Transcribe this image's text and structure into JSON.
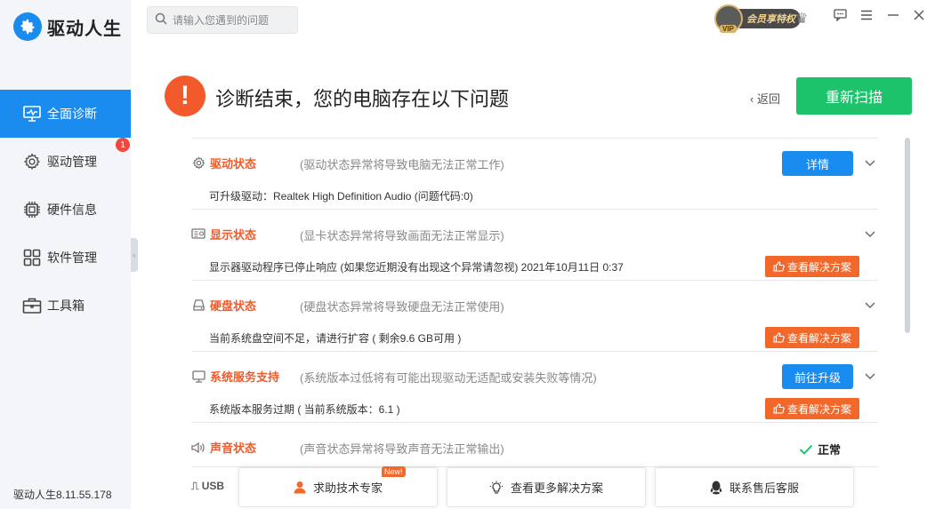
{
  "app": {
    "name": "驱动人生",
    "version": "驱动人生8.11.55.178"
  },
  "search": {
    "placeholder": "请输入您遇到的问题"
  },
  "vip": {
    "tag": "VIP",
    "label": "会员享特权"
  },
  "sidebar": {
    "items": [
      {
        "label": "全面诊断",
        "icon": "monitor-icon",
        "active": true
      },
      {
        "label": "驱动管理",
        "icon": "gear-icon",
        "badge": "1"
      },
      {
        "label": "硬件信息",
        "icon": "chip-icon"
      },
      {
        "label": "软件管理",
        "icon": "grid-icon"
      },
      {
        "label": "工具箱",
        "icon": "toolbox-icon"
      }
    ]
  },
  "header": {
    "title": "诊断结束，您的电脑存在以下问题",
    "back": "返回",
    "rescan": "重新扫描"
  },
  "diagnostics": [
    {
      "name": "驱动状态",
      "desc": "(驱动状态异常将导致电脑无法正常工作)",
      "detail": "可升级驱动：Realtek High Definition Audio (问题代码:0)",
      "button": "详情",
      "icon": "gear-icon"
    },
    {
      "name": "显示状态",
      "desc": "(显卡状态异常将导致画面无法正常显示)",
      "detail": "显示器驱动程序已停止响应 (如果您近期没有出现这个异常请忽视) 2021年10月11日 0:37",
      "solution": "查看解决方案",
      "icon": "display-card-icon"
    },
    {
      "name": "硬盘状态",
      "desc": "(硬盘状态异常将导致硬盘无法正常使用)",
      "detail": "当前系统盘空间不足，请进行扩容 ( 剩余9.6 GB可用 )",
      "solution": "查看解决方案",
      "icon": "disk-icon"
    },
    {
      "name": "系统服务支持",
      "desc": "(系统版本过低将有可能出现驱动无适配或安装失败等情况)",
      "detail": "系统版本服务过期 ( 当前系统版本：6.1 )",
      "button": "前往升级",
      "solution": "查看解决方案",
      "icon": "monitor-icon"
    },
    {
      "name": "声音状态",
      "desc": "(声音状态异常将导致声音无法正常输出)",
      "status": "正常",
      "icon": "speaker-icon"
    }
  ],
  "peek": {
    "text": "USB"
  },
  "bottom": {
    "help": "求助技术专家",
    "new_tag": "New!",
    "more": "查看更多解决方案",
    "support": "联系售后客服"
  },
  "colors": {
    "primary": "#1a8cf0",
    "success": "#1dc36b",
    "warning": "#f25a2b",
    "solution": "#f2682a"
  }
}
